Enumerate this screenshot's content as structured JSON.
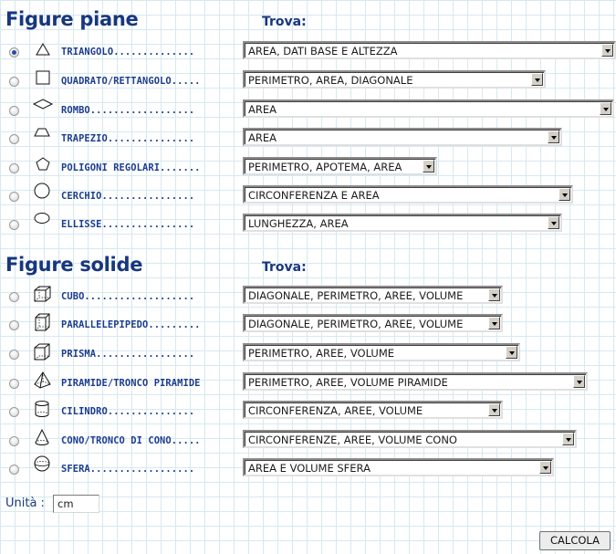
{
  "plane": {
    "title": "Figure piane",
    "find_label": "Trova:",
    "items": [
      {
        "label": "TRIANGOLO..............",
        "option": "AREA, DATI BASE E ALTEZZA",
        "checked": true,
        "icon": "triangle-icon"
      },
      {
        "label": "QUADRATO/RETTANGOLO.....",
        "option": "PERIMETRO, AREA, DIAGONALE",
        "checked": false,
        "icon": "square-icon"
      },
      {
        "label": "ROMBO..................",
        "option": "AREA",
        "checked": false,
        "icon": "rhombus-icon"
      },
      {
        "label": "TRAPEZIO...............",
        "option": "AREA",
        "checked": false,
        "icon": "trapezoid-icon"
      },
      {
        "label": "POLIGONI REGOLARI.......",
        "option": "PERIMETRO, APOTEMA, AREA",
        "checked": false,
        "icon": "pentagon-icon"
      },
      {
        "label": "CERCHIO................",
        "option": "CIRCONFERENZA E AREA",
        "checked": false,
        "icon": "circle-icon"
      },
      {
        "label": "ELLISSE................",
        "option": "LUNGHEZZA, AREA",
        "checked": false,
        "icon": "ellipse-icon"
      }
    ]
  },
  "solid": {
    "title": "Figure solide",
    "find_label": "Trova:",
    "items": [
      {
        "label": "CUBO...................",
        "option": "DIAGONALE, PERIMETRO, AREE, VOLUME",
        "checked": false,
        "icon": "cube-icon"
      },
      {
        "label": "PARALLELEPIPEDO.........",
        "option": "DIAGONALE, PERIMETRO, AREE, VOLUME",
        "checked": false,
        "icon": "cuboid-icon"
      },
      {
        "label": "PRISMA.................",
        "option": "PERIMETRO, AREE, VOLUME",
        "checked": false,
        "icon": "prism-icon"
      },
      {
        "label": "PIRAMIDE/TRONCO PIRAMIDE",
        "option": "PERIMETRO, AREE, VOLUME PIRAMIDE",
        "checked": false,
        "icon": "pyramid-icon"
      },
      {
        "label": "CILINDRO...............",
        "option": "CIRCONFERENZA, AREE, VOLUME",
        "checked": false,
        "icon": "cylinder-icon"
      },
      {
        "label": "CONO/TRONCO DI CONO.....",
        "option": "CIRCONFERENZE, AREE, VOLUME CONO",
        "checked": false,
        "icon": "cone-icon"
      },
      {
        "label": "SFERA..................",
        "option": "AREA E VOLUME SFERA",
        "checked": false,
        "icon": "sphere-icon"
      }
    ]
  },
  "units": {
    "label": "Unità :",
    "value": "cm"
  },
  "calculate_label": "CALCOLA"
}
